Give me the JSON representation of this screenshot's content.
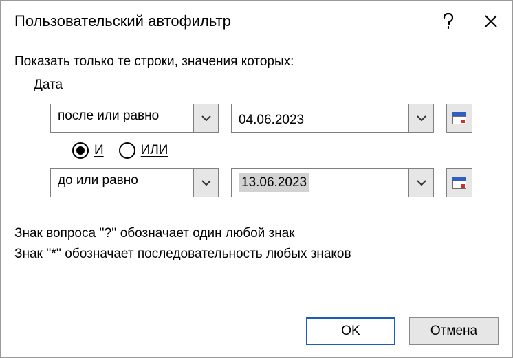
{
  "title": "Пользовательский автофильтр",
  "instruction": "Показать только те строки, значения которых:",
  "field_label": "Дата",
  "row1": {
    "condition": "после или равно",
    "value": "04.06.2023"
  },
  "logic": {
    "and": "И",
    "or": "ИЛИ",
    "selected": "and"
  },
  "row2": {
    "condition": "до или равно",
    "value": "13.06.2023"
  },
  "hints": {
    "q": "Знак вопроса ''?'' обозначает один любой знак",
    "star": "Знак ''*'' обозначает последовательность любых знаков"
  },
  "buttons": {
    "ok": "OK",
    "cancel": "Отмена"
  }
}
